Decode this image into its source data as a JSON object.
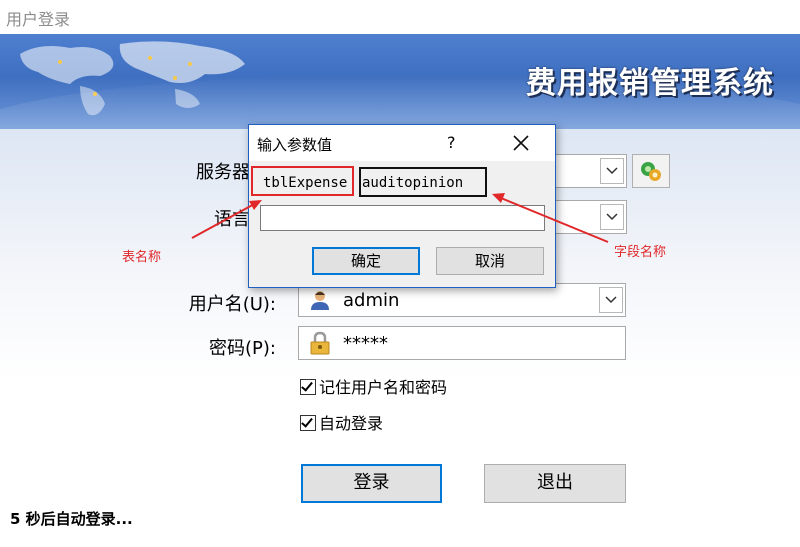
{
  "window": {
    "title": "用户登录"
  },
  "banner": {
    "system_name": "费用报销管理系统"
  },
  "form": {
    "server_label": "服务器",
    "language_label": "语言",
    "username_label": "用户名(U):",
    "password_label": "密码(P):",
    "username_value": "admin",
    "password_value": "*****"
  },
  "options": {
    "remember_label": "记住用户名和密码",
    "autologin_label": "自动登录"
  },
  "buttons": {
    "login": "登录",
    "exit": "退出"
  },
  "status": {
    "countdown_text": "5 秒后自动登录..."
  },
  "dialog": {
    "title": "输入参数值",
    "help": "?",
    "table_text": "tblExpense",
    "field_text": "auditopinion",
    "input_value": "",
    "ok_label": "确定",
    "cancel_label": "取消"
  },
  "annotations": {
    "table_name": "表名称",
    "field_name": "字段名称",
    "color": "#e0282a"
  }
}
